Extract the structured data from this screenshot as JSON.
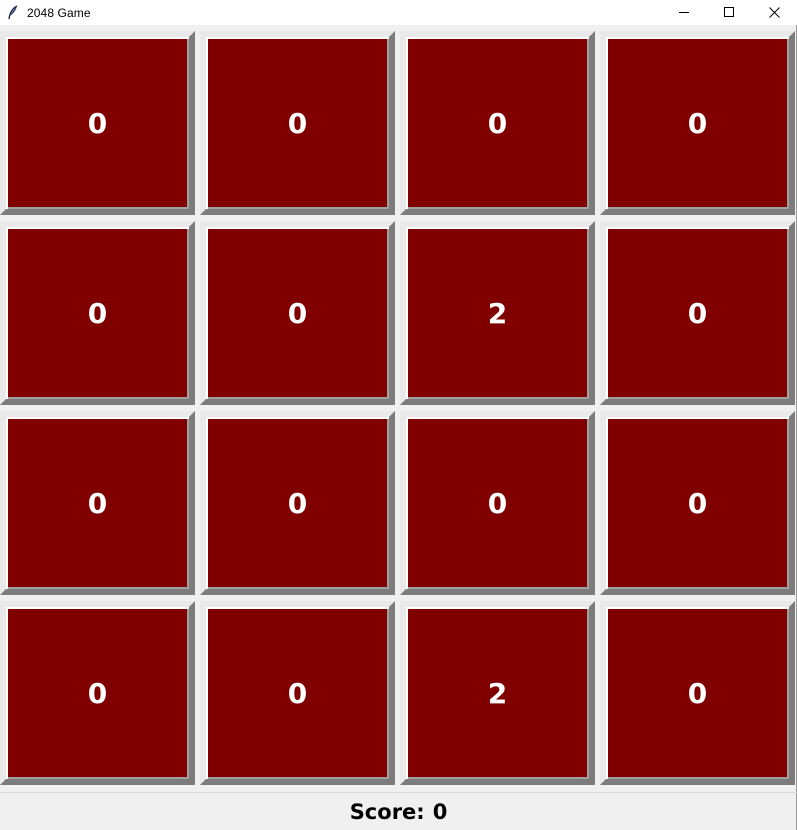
{
  "window": {
    "title": "2048 Game",
    "app_icon": "feather-icon",
    "controls": [
      "minimize-icon",
      "maximize-icon",
      "close-icon"
    ]
  },
  "board": {
    "tile_color": "#800000",
    "text_color": "#ffffff",
    "rows": [
      [
        "0",
        "0",
        "0",
        "0"
      ],
      [
        "0",
        "0",
        "2",
        "0"
      ],
      [
        "0",
        "0",
        "0",
        "0"
      ],
      [
        "0",
        "0",
        "2",
        "0"
      ]
    ]
  },
  "score": {
    "label": "Score:",
    "value": "0"
  }
}
